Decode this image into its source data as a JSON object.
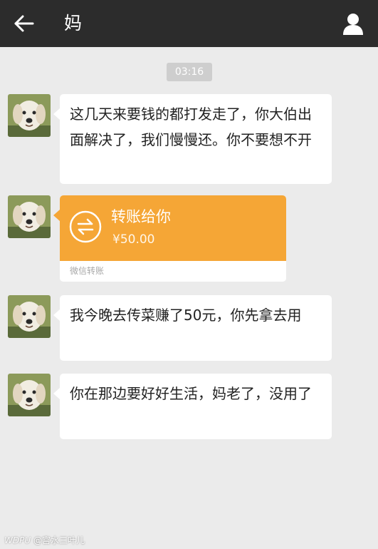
{
  "header": {
    "title": "妈",
    "back_icon": "back-arrow-icon",
    "profile_icon": "person-icon"
  },
  "chat": {
    "timestamp": "03:16",
    "messages": [
      {
        "type": "text",
        "text": "这几天来要钱的都打发走了，你大伯出面解决了，我们慢慢还。你不要想不开"
      },
      {
        "type": "transfer",
        "title": "转账给你",
        "amount": "¥50.00",
        "footer": "微信转账"
      },
      {
        "type": "text",
        "text": "我今晚去传菜赚了50元，你先拿去用"
      },
      {
        "type": "text",
        "text": "你在那边要好好生活，妈老了，没用了"
      }
    ]
  },
  "watermark": {
    "brand": "WDPU",
    "handle": "@宫水三叶儿"
  },
  "colors": {
    "header_bg": "#2c2c2c",
    "chat_bg": "#ebebeb",
    "transfer_orange": "#f5a636",
    "bubble_bg": "#ffffff",
    "timestamp_bg": "#cecece"
  }
}
